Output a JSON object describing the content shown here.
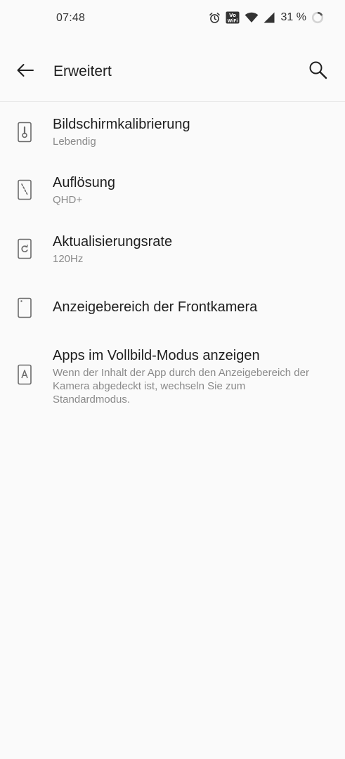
{
  "status": {
    "time": "07:48",
    "battery": "31 %",
    "icons": [
      "alarm-icon",
      "vowifi-icon",
      "wifi-icon",
      "cellular-signal-icon",
      "battery-ring-icon"
    ],
    "vowifi_label_top": "Vo",
    "vowifi_label_bottom": "WiFi"
  },
  "appbar": {
    "title": "Erweitert",
    "back_icon": "arrow-left-icon",
    "search_icon": "search-icon"
  },
  "items": [
    {
      "title": "Bildschirmkalibrierung",
      "subtitle": "Lebendig",
      "icon": "screen-thermometer-icon"
    },
    {
      "title": "Auflösung",
      "subtitle": "QHD+",
      "icon": "screen-resolution-icon"
    },
    {
      "title": "Aktualisierungsrate",
      "subtitle": "120Hz",
      "icon": "screen-refresh-icon"
    },
    {
      "title": "Anzeigebereich der Frontkamera",
      "subtitle": "",
      "icon": "phone-frontcamera-icon"
    },
    {
      "title": "Apps im Vollbild-Modus anzeigen",
      "subtitle": "Wenn der Inhalt der App durch den Anzeigebereich der Kamera abgedeckt ist, wechseln Sie zum Standardmodus.",
      "icon": "phone-app-a-icon"
    }
  ],
  "colors": {
    "background": "#fafafa",
    "title_text": "#1f1f1f",
    "subtitle_text": "#8a8a8a",
    "icon": "#6b6b6b"
  }
}
